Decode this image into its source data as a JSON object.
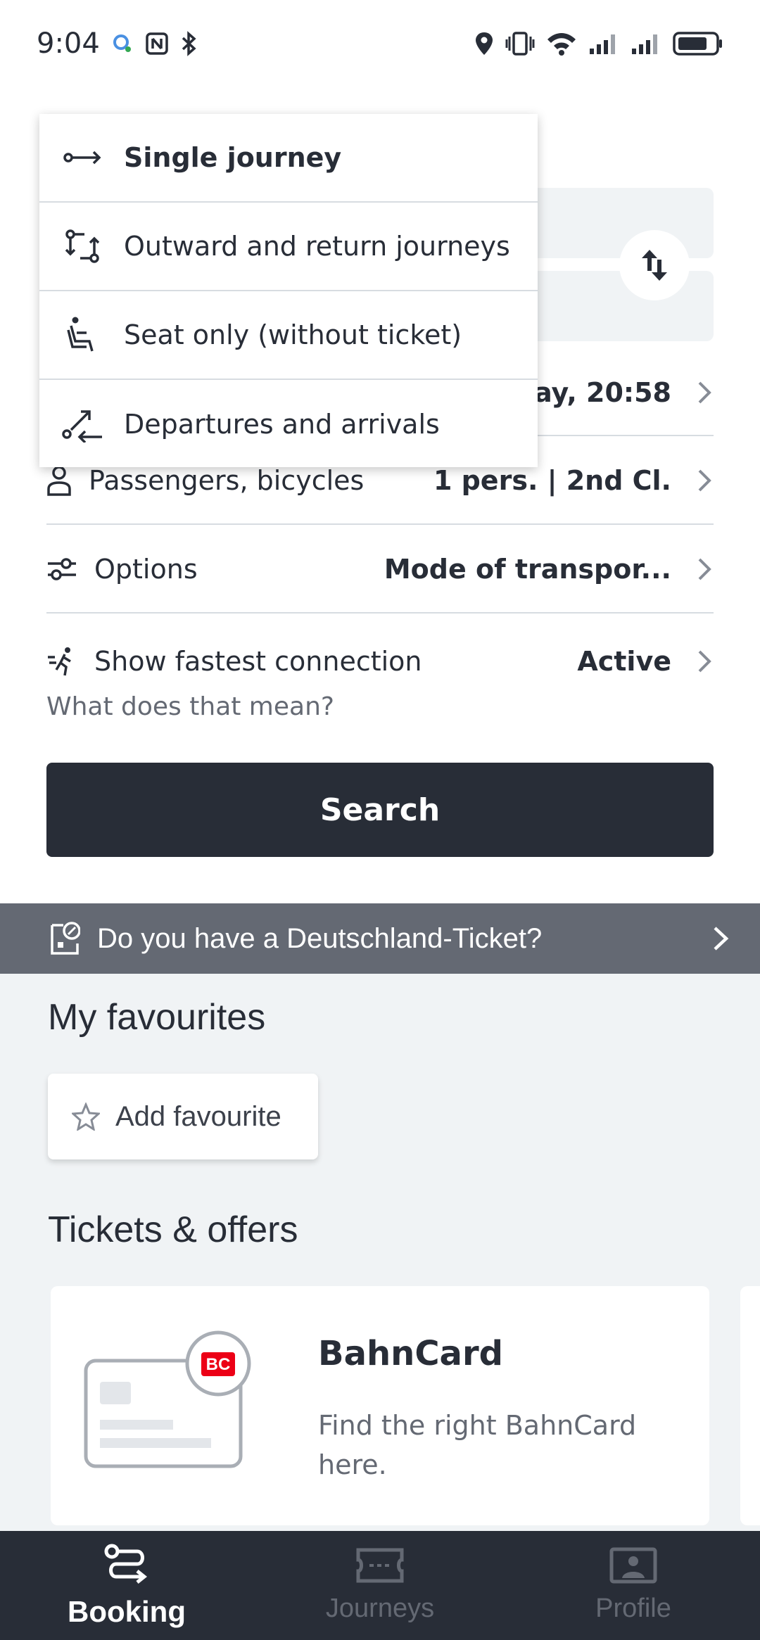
{
  "status_bar": {
    "time": "9:04"
  },
  "dropdown": {
    "items": [
      {
        "label": "Single journey",
        "icon": "single-journey-icon",
        "selected": true
      },
      {
        "label": "Outward and return journeys",
        "icon": "return-journey-icon",
        "selected": false
      },
      {
        "label": "Seat only (without ticket)",
        "icon": "seat-icon",
        "selected": false
      },
      {
        "label": "Departures and arrivals",
        "icon": "departures-arrivals-icon",
        "selected": false
      }
    ]
  },
  "form": {
    "datetime_value_partial": "ay, 20:58",
    "passengers": {
      "label": "Passengers, bicycles",
      "value": "1 pers. | 2nd Cl."
    },
    "options": {
      "label": "Options",
      "value": "Mode of transpor..."
    },
    "fastest": {
      "label": "Show fastest connection",
      "value": "Active",
      "help": "What does that mean?"
    },
    "search_label": "Search"
  },
  "banner": {
    "text": "Do you have a Deutschland-Ticket?"
  },
  "favourites": {
    "title": "My favourites",
    "add_label": "Add favourite"
  },
  "offers": {
    "title": "Tickets & offers",
    "card": {
      "title": "BahnCard",
      "description": "Find the right BahnCard here.",
      "badge": "BC"
    }
  },
  "bottom_nav": {
    "items": [
      {
        "label": "Booking",
        "active": true
      },
      {
        "label": "Journeys",
        "active": false
      },
      {
        "label": "Profile",
        "active": false
      }
    ]
  },
  "colors": {
    "dark": "#282d37",
    "gray": "#646973",
    "light_bg": "#f0f3f5",
    "brand_red": "#ec0016"
  }
}
